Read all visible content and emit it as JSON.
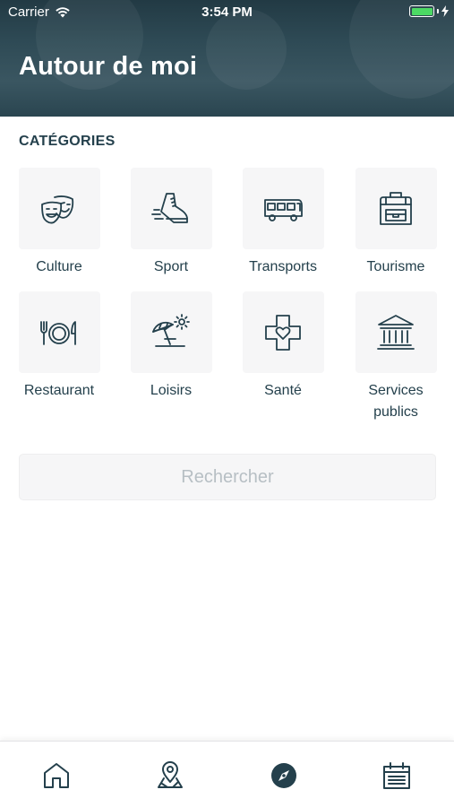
{
  "status_bar": {
    "carrier": "Carrier",
    "time": "3:54 PM",
    "battery_color": "#4cd964"
  },
  "header": {
    "title": "Autour de moi"
  },
  "categories": {
    "title": "CATÉGORIES",
    "items": [
      {
        "label": "Culture",
        "icon": "theater-masks-icon"
      },
      {
        "label": "Sport",
        "icon": "running-shoe-icon"
      },
      {
        "label": "Transports",
        "icon": "bus-icon"
      },
      {
        "label": "Tourisme",
        "icon": "backpack-icon"
      },
      {
        "label": "Restaurant",
        "icon": "plate-cutlery-icon"
      },
      {
        "label": "Loisirs",
        "icon": "beach-umbrella-icon"
      },
      {
        "label": "Santé",
        "icon": "health-cross-icon"
      },
      {
        "label": "Services publics",
        "icon": "public-building-icon"
      }
    ]
  },
  "search": {
    "label": "Rechercher"
  },
  "tabbar": {
    "tabs": [
      {
        "icon": "home-icon"
      },
      {
        "icon": "map-pin-icon"
      },
      {
        "icon": "compass-icon",
        "active": true
      },
      {
        "icon": "calendar-icon"
      }
    ]
  },
  "colors": {
    "primary": "#24404c",
    "tile_bg": "#f6f6f7",
    "placeholder": "#b7bfc4"
  }
}
